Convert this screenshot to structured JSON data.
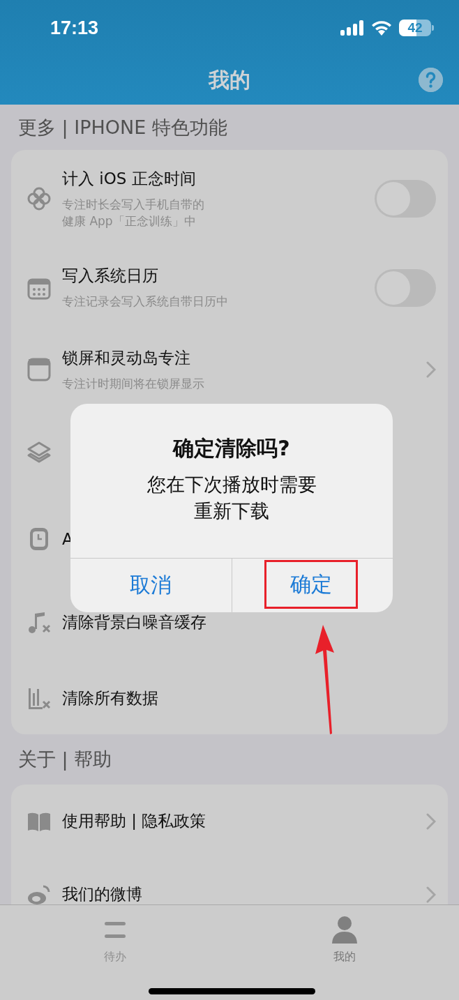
{
  "status_bar": {
    "time": "17:13",
    "battery": "42"
  },
  "nav": {
    "title": "我的"
  },
  "sections": [
    {
      "header": "更多 | IPHONE 特色功能",
      "rows": [
        {
          "title": "计入 iOS 正念时间",
          "subtitle_lines": [
            "专注时长会写入手机自带的",
            "健康 App「正念训练」中"
          ],
          "kind": "toggle",
          "on": false
        },
        {
          "title": "写入系统日历",
          "subtitle_lines": [
            "专注记录会写入系统自带日历中"
          ],
          "kind": "toggle",
          "on": false
        },
        {
          "title": "锁屏和灵动岛专注",
          "subtitle_lines": [
            "专注计时期间将在锁屏显示"
          ],
          "kind": "link"
        },
        {
          "kind": "plain"
        },
        {
          "title": "A",
          "kind": "plain"
        },
        {
          "title": "清除背景白噪音缓存",
          "kind": "plain"
        },
        {
          "title": "清除所有数据",
          "kind": "plain"
        }
      ]
    },
    {
      "header": "关于 | 帮助",
      "rows": [
        {
          "title": "使用帮助 | 隐私政策",
          "kind": "link"
        },
        {
          "title": "我们的微博",
          "kind": "link"
        }
      ]
    }
  ],
  "dialog": {
    "title": "确定清除吗?",
    "message_lines": [
      "您在下次播放时需要",
      "重新下载"
    ],
    "buttons": [
      {
        "label": "取消",
        "highlighted": false
      },
      {
        "label": "确定",
        "highlighted": true
      }
    ]
  },
  "tabs": [
    {
      "label": "待办",
      "selected": false
    },
    {
      "label": "我的",
      "selected": true
    }
  ]
}
